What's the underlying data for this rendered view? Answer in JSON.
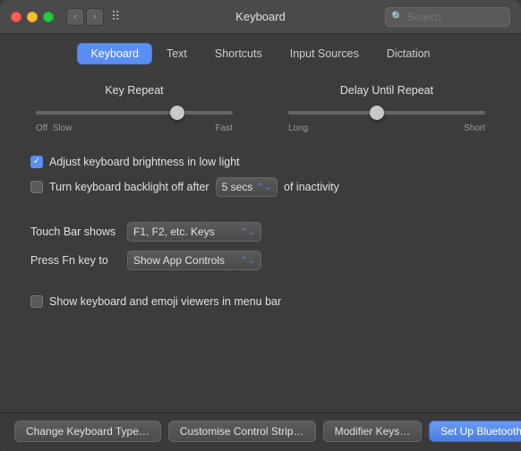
{
  "window": {
    "title": "Keyboard"
  },
  "title_bar": {
    "close_label": "",
    "minimize_label": "",
    "maximize_label": "",
    "back_label": "‹",
    "forward_label": "›",
    "search_placeholder": "Search"
  },
  "tabs": [
    {
      "id": "keyboard",
      "label": "Keyboard",
      "active": true
    },
    {
      "id": "text",
      "label": "Text",
      "active": false
    },
    {
      "id": "shortcuts",
      "label": "Shortcuts",
      "active": false
    },
    {
      "id": "input-sources",
      "label": "Input Sources",
      "active": false
    },
    {
      "id": "dictation",
      "label": "Dictation",
      "active": false
    }
  ],
  "sliders": {
    "key_repeat": {
      "label": "Key Repeat",
      "left_label": "Off",
      "left_label2": "Slow",
      "right_label": "Fast",
      "thumb_position_pct": 72
    },
    "delay_until_repeat": {
      "label": "Delay Until Repeat",
      "left_label": "Long",
      "right_label": "Short",
      "thumb_position_pct": 45
    }
  },
  "options": {
    "adjust_brightness": {
      "label": "Adjust keyboard brightness in low light",
      "checked": true
    },
    "backlight_off": {
      "label": "Turn keyboard backlight off after",
      "checked": false,
      "dropdown_value": "5 secs",
      "dropdown_suffix": "of inactivity"
    },
    "touch_bar": {
      "label": "Touch Bar shows",
      "dropdown_value": "F1, F2, etc. Keys"
    },
    "fn_key": {
      "label": "Press Fn key to",
      "dropdown_value": "Show App Controls"
    },
    "show_viewers": {
      "label": "Show keyboard and emoji viewers in menu bar",
      "checked": false
    }
  },
  "bottom_buttons": {
    "change_keyboard_type": "Change Keyboard Type…",
    "customise_control_strip": "Customise Control Strip…",
    "modifier_keys": "Modifier Keys…",
    "setup_bluetooth": "Set Up Bluetooth Keyboard…",
    "help": "?"
  }
}
